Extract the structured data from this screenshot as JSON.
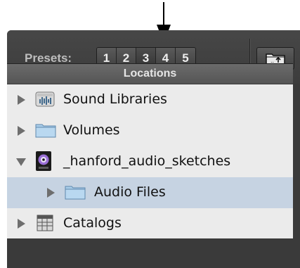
{
  "toolbar": {
    "presets_label": "Presets:",
    "preset_buttons": [
      "1",
      "2",
      "3",
      "4",
      "5"
    ],
    "active_preset": "3",
    "folder_button_icon": "folder-up-icon"
  },
  "locations": {
    "header": "Locations",
    "items": [
      {
        "label": "Sound Libraries",
        "icon": "sound-library-icon",
        "expanded": false
      },
      {
        "label": "Volumes",
        "icon": "folder-icon",
        "expanded": false
      },
      {
        "label": "_hanford_audio_sketches",
        "icon": "session-icon",
        "expanded": true
      },
      {
        "label": "Audio Files",
        "icon": "folder-icon",
        "expanded": false,
        "selected": true
      },
      {
        "label": "Catalogs",
        "icon": "catalog-icon",
        "expanded": false
      }
    ]
  },
  "colors": {
    "toolbar_bg": "#3c3c3c",
    "list_bg": "#ebebeb",
    "selection": "#c6d3e2",
    "folder_blue": "#a9cde9"
  }
}
